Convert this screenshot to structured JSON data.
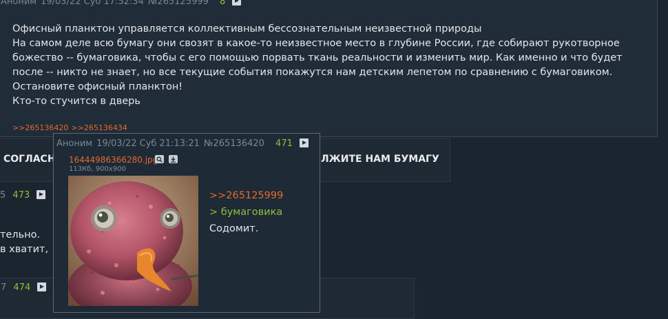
{
  "post_main": {
    "author": "Аноним",
    "date": "19/03/22 Суб 17:52:34",
    "number": "№265125999",
    "reply_count": "8",
    "lines": [
      "Офисный планктон управляется коллективным бессознательным неизвестной природы",
      "На самом деле всю бумагу они свозят в какое-то неизвестное место в глубине России, где собирают рукотворное",
      "божество -- бумаговика, чтобы с его помощью порвать ткань реальности и изменить мир. Как именно и что будет",
      "после -- никто не знает, но все текущие события покажутся нам детским лепетом по сравнению с бумаговиком.",
      "Остановите офисный планктон!",
      "Кто-то стучится в дверь"
    ],
    "replies": [
      ">>265136420",
      ">>265136434"
    ]
  },
  "strip_mid": {
    "left_text": "СОГЛАСН",
    "right_text": "ЛЖИТЕ НАМ БУМАГУ"
  },
  "post_b": {
    "number_tail": "5",
    "reply_count": "473",
    "line1": "тельно.",
    "line2": "в хватит, "
  },
  "post_c": {
    "number_tail": "7",
    "reply_count": "474"
  },
  "popup": {
    "author": "Аноним",
    "date": "19/03/22 Суб 21:13:21",
    "number": "№265136420",
    "reply_count": "471",
    "file_name": "16444986366280.jpg",
    "file_meta": "113Кб, 900x900",
    "quote_link": ">>265125999",
    "greentext": "> бумаговика",
    "text": "Содомит."
  },
  "icons": {
    "play": "play-icon",
    "search": "magnifier-icon",
    "download": "download-icon"
  },
  "colors": {
    "background": "#1b2530",
    "link": "#e56a2c",
    "green": "#8ec03c"
  }
}
